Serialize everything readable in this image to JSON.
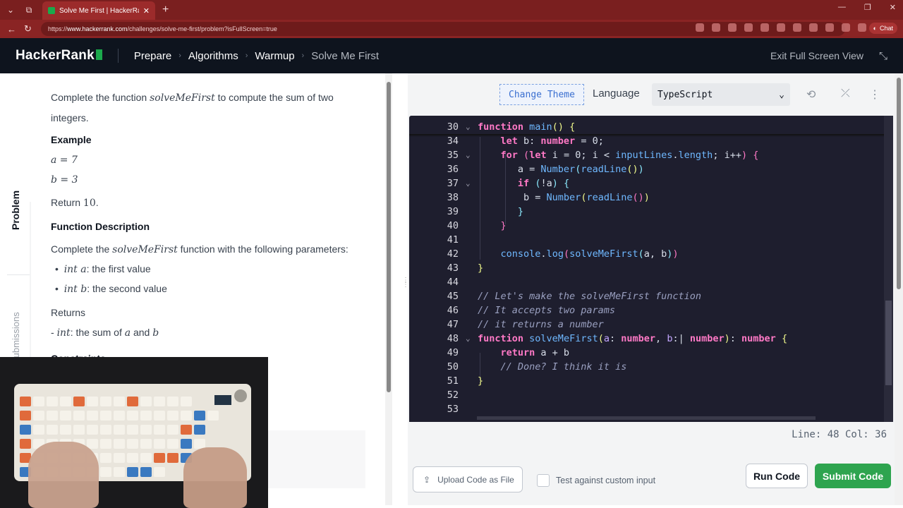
{
  "browser": {
    "tab_title": "Solve Me First | HackerRank",
    "url_prefix": "https://",
    "url_domain": "www.hackerrank.com",
    "url_path": "/challenges/solve-me-first/problem?isFullScreen=true",
    "chat_label": "Chat"
  },
  "header": {
    "logo_text": "HackerRank",
    "breadcrumbs": [
      "Prepare",
      "Algorithms",
      "Warmup",
      "Solve Me First"
    ],
    "exit_label": "Exit Full Screen View"
  },
  "sidebar": {
    "tab_problem": "Problem",
    "tab_submissions": "Submissions"
  },
  "problem": {
    "intro_a": "Complete the function ",
    "intro_fn": "solveMeFirst",
    "intro_b": " to compute the sum of two integers.",
    "example_heading": "Example",
    "example_a": "a = 7",
    "example_b": "b = 3",
    "return_text": "Return ",
    "return_value": "10",
    "return_end": ".",
    "func_desc_heading": "Function Description",
    "func_desc_a": "Complete the ",
    "func_desc_fn": "solveMeFirst",
    "func_desc_b": " function with the following parameters:",
    "param1_type": "int a",
    "param1_desc": ": the first value",
    "param2_type": "int b",
    "param2_desc": ": the second value",
    "returns_heading": "Returns",
    "returns_dash": "- ",
    "returns_type": "int",
    "returns_desc_a": ": the sum of ",
    "returns_var_a": "a",
    "returns_and": " and ",
    "returns_var_b": "b",
    "constraints_heading": "Constraints"
  },
  "editor": {
    "change_theme_label": "Change Theme",
    "language_label": "Language",
    "language_value": "TypeScript",
    "status_text": "Line: 48 Col: 36",
    "line_numbers": [
      "30",
      "34",
      "35",
      "36",
      "37",
      "38",
      "39",
      "40",
      "41",
      "42",
      "43",
      "44",
      "45",
      "46",
      "47",
      "48",
      "49",
      "50",
      "51",
      "52",
      "53"
    ],
    "comment_45": "// Let's make the solveMeFirst function",
    "comment_46": "// It accepts two params",
    "comment_47": "// it returns a number",
    "comment_50": "// Done? I think it is"
  },
  "actions": {
    "upload_label": "Upload Code as File",
    "custom_input_label": "Test against custom input",
    "run_label": "Run Code",
    "submit_label": "Submit Code"
  },
  "colors": {
    "brand_green": "#1ba94c",
    "submit_green": "#2ea44f",
    "header_bg": "#0e141e",
    "browser_bg": "#7a1f1f"
  }
}
